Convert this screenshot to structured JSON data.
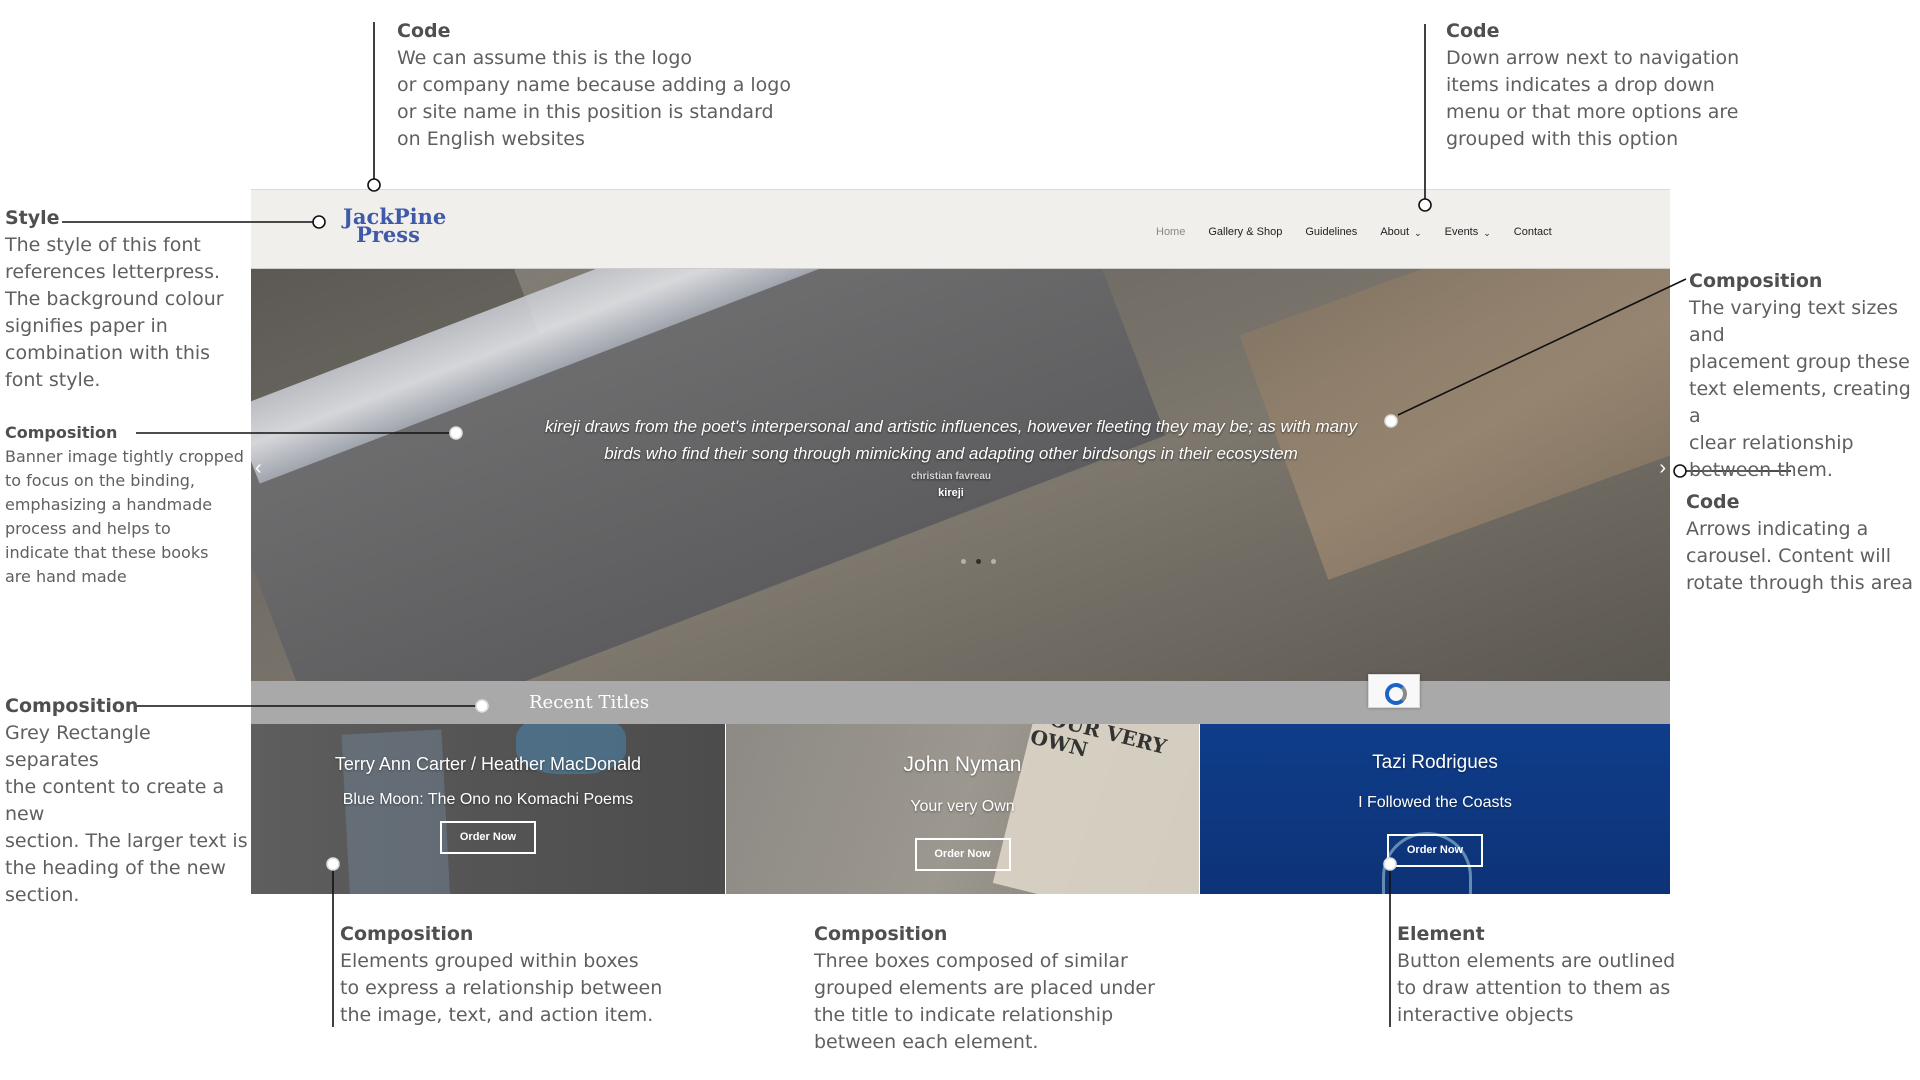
{
  "annotations": {
    "code_logo": {
      "title": "Code",
      "body": "We can assume this is the logo\nor company name because adding a logo\nor site name in this position is standard\non English websites"
    },
    "code_nav": {
      "title": "Code",
      "body": "Down arrow next to navigation\nitems indicates a drop down\nmenu or that more options are\ngrouped with this option"
    },
    "style_font": {
      "title": "Style",
      "body": "The style of this font\nreferences letterpress.\nThe background colour\nsignifies paper in\ncombination with this\nfont style."
    },
    "composition_banner": {
      "title": "Composition",
      "body": "Banner image tightly cropped\nto focus on the binding,\nemphasizing a handmade\nprocess and helps to\nindicate that these books\nare hand made"
    },
    "composition_text": {
      "title": "Composition",
      "body": "The varying text sizes and\nplacement group these\ntext elements, creating a\nclear relationship\nbetween them."
    },
    "code_arrows": {
      "title": "Code",
      "body": "Arrows indicating a\ncarousel. Content will\nrotate through this area"
    },
    "composition_grey": {
      "title": "Composition",
      "body": "Grey Rectangle separates\nthe content to create a new\nsection. The larger text is\nthe heading of the new\nsection."
    },
    "composition_boxes": {
      "title": "Composition",
      "body": "Elements grouped within boxes\nto express a relationship between\nthe image, text, and action item."
    },
    "composition_three": {
      "title": "Composition",
      "body": "Three boxes composed of similar\ngrouped elements are placed under\nthe title to indicate relationship\nbetween each element."
    },
    "element_buttons": {
      "title": "Element",
      "body": "Button elements are outlined\nto draw attention to them as\ninteractive objects"
    }
  },
  "site": {
    "logo": {
      "line1": "JackPine",
      "line2": "Press"
    },
    "nav": [
      {
        "label": "Home"
      },
      {
        "label": "Gallery & Shop"
      },
      {
        "label": "Guidelines"
      },
      {
        "label": "About",
        "dropdown_icon": "chevron-down-icon"
      },
      {
        "label": "Events",
        "dropdown_icon": "chevron-down-icon"
      },
      {
        "label": "Contact"
      }
    ],
    "hero": {
      "quote": "kireji draws from the poet's interpersonal and artistic influences, however fleeting they may be; as with many birds who find their song through mimicking and adapting other birdsongs in their ecosystem",
      "author": "christian favreau",
      "book": "kireji",
      "prev_icon": "chevron-left-icon",
      "next_icon": "chevron-right-icon",
      "slide_count": 3,
      "active_slide": 2
    },
    "section_title": "Recent Titles",
    "tiles": [
      {
        "author": "Terry Ann Carter / Heather MacDonald",
        "title": "Blue Moon: The Ono no Komachi Poems",
        "button": "Order Now"
      },
      {
        "author": "John Nyman",
        "title": "Your very Own",
        "button": "Order Now",
        "cover_text": "YOUR VERY OWN"
      },
      {
        "author": "Tazi Rodrigues",
        "title": "I Followed the Coasts",
        "button": "Order Now"
      }
    ],
    "recaptcha_icon": "recaptcha-icon"
  },
  "colors": {
    "logo_blue": "#3f5aa8",
    "header_bg": "#f1efec",
    "section_bar": "#a9a9a9",
    "tile_blue": "#0f3d8a"
  }
}
